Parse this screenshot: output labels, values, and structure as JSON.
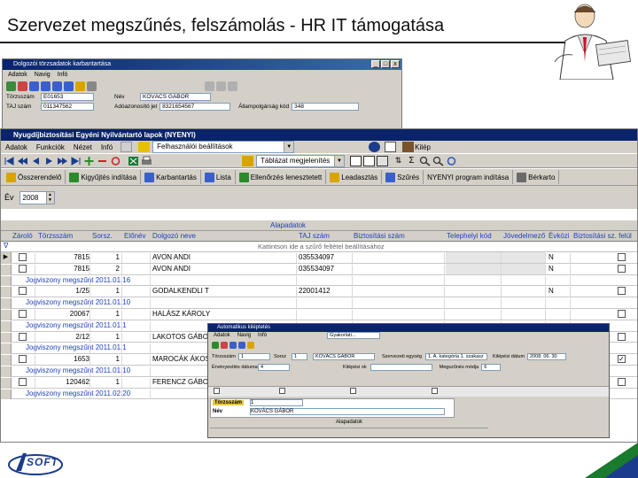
{
  "slide_title": "Szervezet megszűnés, felszámolás - HR IT támogatása",
  "logo_text": "SOFT",
  "back_window": {
    "title": "Dolgozói törzsadatok karbantartása",
    "menu": [
      "Adatok",
      "Navig",
      "Infó"
    ],
    "fields": [
      {
        "label": "Törzsszám",
        "value": "E01653",
        "label2": "Név",
        "value2": "KOVÁCS GÁBOR"
      },
      {
        "label": "TAJ szám",
        "value": "011347562",
        "label2": "Adóazonosító jel",
        "value2": "8321654567",
        "label3": "Állampolgárság kód",
        "value3": "348"
      }
    ]
  },
  "main_window": {
    "title": "Nyugdíjbiztosítási Egyéni Nyilvántartó lapok (NYENYI)",
    "title_buttons": [
      "_",
      "□",
      "X"
    ],
    "menu": [
      "Adatok",
      "Funkciók",
      "Nézet",
      "Infó"
    ],
    "filter_combo": "Felhasználói beállítások",
    "exit_label": "Kilép",
    "layout_combo": "Táblázat megjelenítés",
    "action_buttons": [
      "Összerendelő",
      "Kigyűjtés indítása",
      "Karbantartás",
      "Lista",
      "Ellenőrzés lenesztetett",
      "Leadasztás",
      "Szűrés",
      "NYENYI program indítása",
      "Bérkarto"
    ],
    "year_label": "Év",
    "year_value": "2008",
    "group_header": "Alapadatok",
    "columns": [
      "Zároló",
      "Törzsszám",
      "Sorsz.",
      "Előnév",
      "Dolgozó neve",
      "TAJ szám",
      "Biztosítási szám",
      "Telephelyi kód",
      "Jövedelmező",
      "Évközi",
      "Biztosítási sz. felül"
    ],
    "filter_hint": "Kattintson ide a szűrő feltétel beállításához",
    "rows": [
      {
        "kind": "main",
        "tsz": "7815",
        "sor": "1",
        "name": "AVON ANDI",
        "taj": "035534097",
        "n": "N",
        "checked": false
      },
      {
        "kind": "main",
        "tsz": "7815",
        "sor": "2",
        "name": "AVON ANDI",
        "taj": "035534097",
        "n": "N",
        "checked": false
      },
      {
        "kind": "sub",
        "text": "Jogviszony megszűnt 2011.01.16"
      },
      {
        "kind": "main",
        "tsz": "1/25",
        "sor": "1",
        "name": "GODALKENDLI T",
        "taj": "22001412",
        "n": "N",
        "checked": false
      },
      {
        "kind": "sub",
        "text": "Jogviszony megszűnt 2011.01.10"
      },
      {
        "kind": "main",
        "tsz": "20067",
        "sor": "1",
        "name": "HALÁSZ KÁROLY",
        "taj": "",
        "n": "",
        "checked": false
      },
      {
        "kind": "sub",
        "text": "Jogviszony megszűnt 2011.01.1"
      },
      {
        "kind": "main",
        "tsz": "2/12",
        "sor": "1",
        "name": "LAKOTOS GÁBOR",
        "taj": "",
        "n": "",
        "checked": false
      },
      {
        "kind": "sub",
        "text": "Jogviszony megszűnt 2011.01.1"
      },
      {
        "kind": "main",
        "tsz": "1653",
        "sor": "1",
        "name": "MAROCÁK ÁKOS",
        "taj": "",
        "n": "",
        "checked": true
      },
      {
        "kind": "sub",
        "text": "Jogviszony megszűnt 2011.01.10"
      },
      {
        "kind": "main",
        "tsz": "120462",
        "sor": "1",
        "name": "FERENCZ GÁBOR",
        "taj": "",
        "n": "",
        "checked": false
      },
      {
        "kind": "sub",
        "text": "Jogviszony megszűnt 2011.02.20"
      }
    ]
  },
  "popup_window": {
    "title": "Automatikus kiléptetés",
    "menu": [
      "Adatok",
      "Navig",
      "Infó"
    ],
    "combo": "Gyakorlati...",
    "fields": [
      {
        "label": "Törzsszám",
        "value": "1"
      },
      {
        "label": "Sorsz",
        "value": "1"
      },
      {
        "label": "Név",
        "value": "KOVÁCS GÁBOR"
      },
      {
        "label": "Szervezeti egység",
        "value": "1. A. kategória 1. szakasz"
      },
      {
        "label": "Kilépési dátum",
        "value": "2008. 06. 30"
      },
      {
        "label": "Érvényesítés dátuma",
        "value": "4"
      },
      {
        "label": "Kilépési ok",
        "value": ""
      },
      {
        "label": "Megszűnés módja",
        "value": "6"
      }
    ],
    "tsz_label": "Törzsszám",
    "tsz_value": "1",
    "nev_label": "Név",
    "nev_value": "KOVÁCS GÁBOR",
    "bottom_label": "Alapadatok"
  },
  "colors": {
    "title_bar": "#0a246a",
    "window_bg": "#d4d0c8",
    "header_text": "#1f3fbf",
    "grid_line": "#c8c8c8"
  }
}
